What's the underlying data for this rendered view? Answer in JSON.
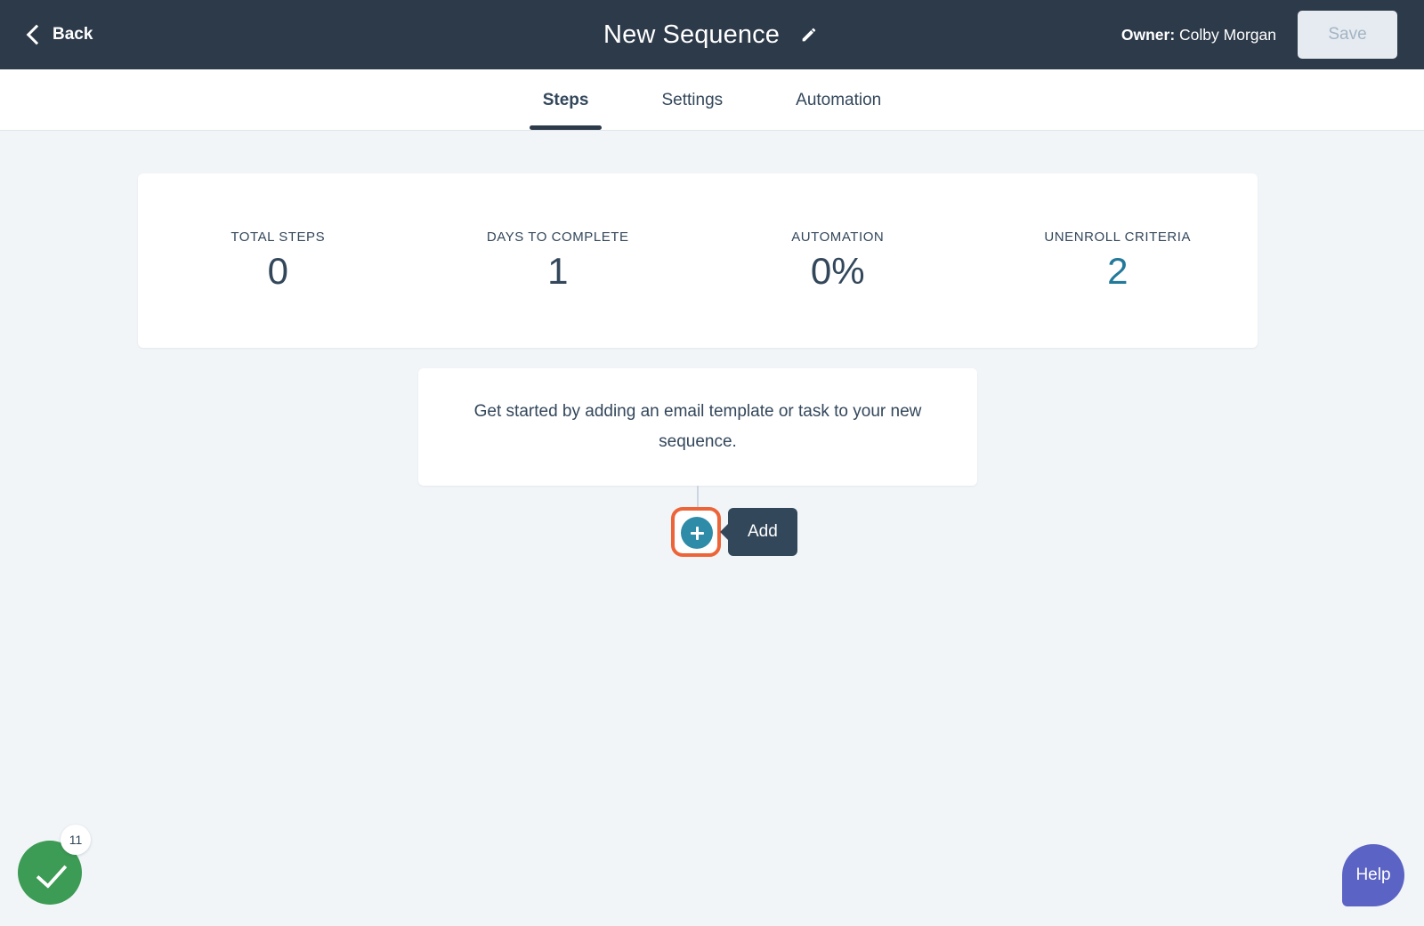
{
  "header": {
    "back_label": "Back",
    "title": "New Sequence",
    "edit_icon": "pencil-icon",
    "owner_label": "Owner:",
    "owner_name": "Colby Morgan",
    "save_label": "Save",
    "background_color": "#2D3A4A"
  },
  "tabs": [
    {
      "label": "Steps",
      "active": true
    },
    {
      "label": "Settings",
      "active": false
    },
    {
      "label": "Automation",
      "active": false
    }
  ],
  "stats": [
    {
      "label": "TOTAL STEPS",
      "value": "0",
      "accent": false
    },
    {
      "label": "DAYS TO COMPLETE",
      "value": "1",
      "accent": false
    },
    {
      "label": "AUTOMATION",
      "value": "0%",
      "accent": false
    },
    {
      "label": "UNENROLL CRITERIA",
      "value": "2",
      "accent": true
    }
  ],
  "empty_state": {
    "message": "Get started by adding an email template or task to your new sequence."
  },
  "add_step": {
    "icon": "plus-icon",
    "tooltip_label": "Add",
    "highlight_color": "#EC6437",
    "button_color": "#2E8CA8",
    "tooltip_color": "#33475B"
  },
  "success_widget": {
    "icon": "check-icon",
    "badge_count": "11",
    "color": "#3C9B54"
  },
  "help": {
    "label": "Help",
    "color": "#5B63C4"
  },
  "colors": {
    "page_background": "#F2F5F8",
    "text": "#33475B",
    "accent_teal": "#22799A",
    "connector": "#CBD6E2"
  }
}
